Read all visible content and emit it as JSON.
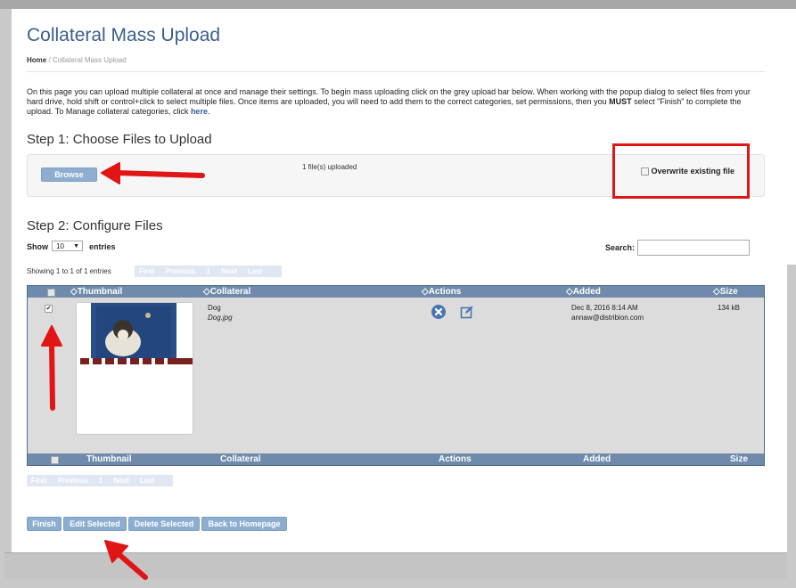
{
  "page": {
    "title": "Collateral Mass Upload",
    "breadcrumb": {
      "home": "Home",
      "separator": "/",
      "current": "Collateral Mass Upload"
    },
    "intro": {
      "text1": "On this page you can upload multiple collateral at once and manage their settings. To begin mass uploading click on the grey upload bar below. When working with the popup dialog to select files from your hard drive, hold shift or control+click to select multiple files. Once items are uploaded, you will need to add them to the correct categories, set permissions, then you ",
      "must": "MUST",
      "text2": " select \"Finish\" to complete the upload. To Manage collateral categories, click ",
      "here": "here",
      "end": "."
    }
  },
  "step1": {
    "heading": "Step 1: Choose Files to Upload",
    "browse_label": "Browse",
    "status": "1 file(s) uploaded",
    "overwrite_label": "Overwrite existing file"
  },
  "step2": {
    "heading": "Step 2: Configure Files",
    "show_label": "Show",
    "entries_value": "10",
    "entries_label": "entries",
    "search_label": "Search:",
    "showing_text": "Showing 1 to 1 of 1 entries",
    "pager": {
      "first": "First",
      "previous": "Previous",
      "page": "1",
      "next": "Next",
      "last": "Last"
    },
    "columns": {
      "thumbnail": "Thumbnail",
      "collateral": "Collateral",
      "actions": "Actions",
      "added": "Added",
      "size": "Size"
    },
    "row": {
      "checked": true,
      "name": "Dog",
      "filename": "Dog.jpg",
      "added_date": "Dec 8, 2016 8:14 AM",
      "added_by": "annaw@distribion.com",
      "size": "134 kB"
    }
  },
  "bottom_buttons": {
    "finish": "Finish",
    "edit_selected": "Edit Selected",
    "delete_selected": "Delete Selected",
    "back": "Back to Homepage"
  },
  "colors": {
    "accent": "#3a5f8c",
    "button": "#8eaed0",
    "table_header": "#6f8aaa",
    "annotation_red": "#e11515"
  }
}
